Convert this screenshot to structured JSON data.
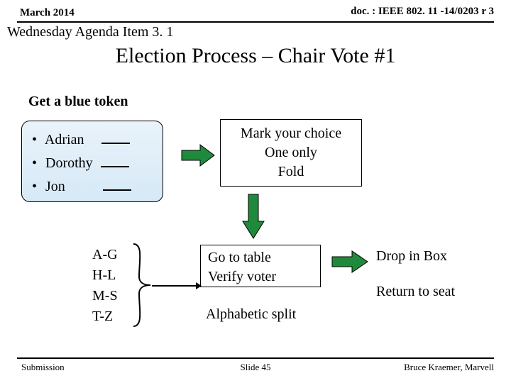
{
  "header": {
    "date": "March 2014",
    "doc": "doc. : IEEE 802. 11 -14/0203 r 3",
    "agenda": "Wednesday Agenda Item 3. 1"
  },
  "title": "Election Process – Chair Vote #1",
  "get_token": "Get a blue token",
  "ballot": {
    "rows": [
      {
        "name": "Adrian"
      },
      {
        "name": "Dorothy"
      },
      {
        "name": "Jon"
      }
    ]
  },
  "choice": {
    "l1": "Mark your choice",
    "l2": "One only",
    "l3": "Fold"
  },
  "alpha": {
    "r1": "A-G",
    "r2": "H-L",
    "r3": "M-S",
    "r4": "T-Z"
  },
  "verify": {
    "l1": "Go to table",
    "l2": "Verify voter"
  },
  "alpha_split": "Alphabetic split",
  "drop": "Drop in Box",
  "return_seat": "Return to seat",
  "footer": {
    "submission": "Submission",
    "slide": "Slide 45",
    "author": "Bruce Kraemer, Marvell"
  }
}
